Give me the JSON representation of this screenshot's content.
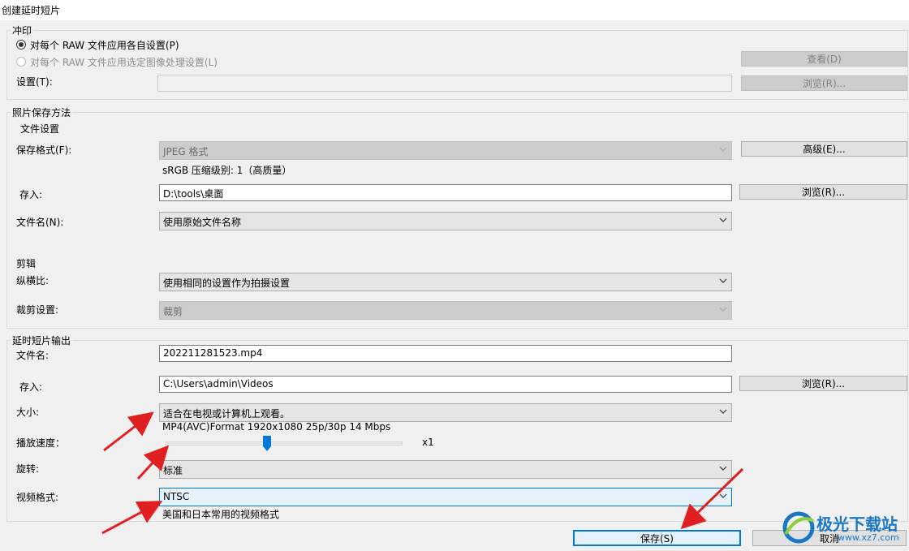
{
  "window": {
    "title": "创建延时短片"
  },
  "print": {
    "group_label": "冲印",
    "radio_each": "对每个 RAW 文件应用各自设置(P)",
    "radio_selected": "对每个 RAW 文件应用选定图像处理设置(L)",
    "settings_label": "设置(T):",
    "settings_value": "",
    "view_button": "查看(D)",
    "browse_button": "浏览(R)..."
  },
  "photo_save": {
    "group_label": "照片保存方法",
    "file_settings_label": "文件设置",
    "format_label": "保存格式(F):",
    "format_value": "JPEG 格式",
    "format_info": "sRGB 压缩级别: 1（高质量）",
    "advanced_button": "高级(E)...",
    "save_to_label": "存入:",
    "save_to_value": "D:\\tools\\桌面",
    "browse_button": "浏览(R)...",
    "filename_label": "文件名(N):",
    "filename_value": "使用原始文件名称",
    "crop_section_label": "剪辑",
    "aspect_label": "纵横比:",
    "aspect_value": "使用相同的设置作为拍摄设置",
    "crop_label": "裁剪设置:",
    "crop_value": "裁剪"
  },
  "output": {
    "group_label": "延时短片输出",
    "filename_label": "文件名:",
    "filename_value": "202211281523.mp4",
    "save_to_label": "存入:",
    "save_to_value": "C:\\Users\\admin\\Videos",
    "browse_button": "浏览(R)...",
    "size_label": "大小:",
    "size_value": "适合在电视或计算机上观看。",
    "size_info": "MP4(AVC)Format 1920x1080 25p/30p 14 Mbps",
    "speed_label": "播放速度：",
    "speed_value_label": "x1",
    "speed_position": 0.43,
    "rotate_label": "旋转:",
    "rotate_value": "标准",
    "video_format_label": "视频格式:",
    "video_format_value": "NTSC",
    "video_format_info": "美国和日本常用的视频格式"
  },
  "footer": {
    "save_button": "保存(S)",
    "cancel_button": "取消"
  },
  "watermark": {
    "text_cn": "极光下载站",
    "text_url": "www.xz7.com"
  },
  "colors": {
    "accent": "#0078d7",
    "annotation_arrow": "#e02020"
  }
}
